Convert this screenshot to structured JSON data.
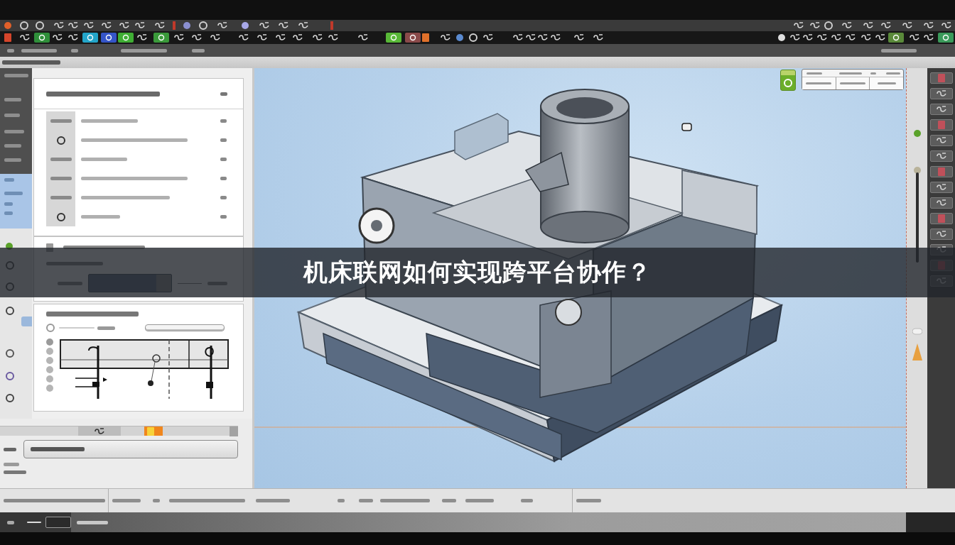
{
  "banner": {
    "title": "机床联网如何实现跨平台协作？"
  }
}
